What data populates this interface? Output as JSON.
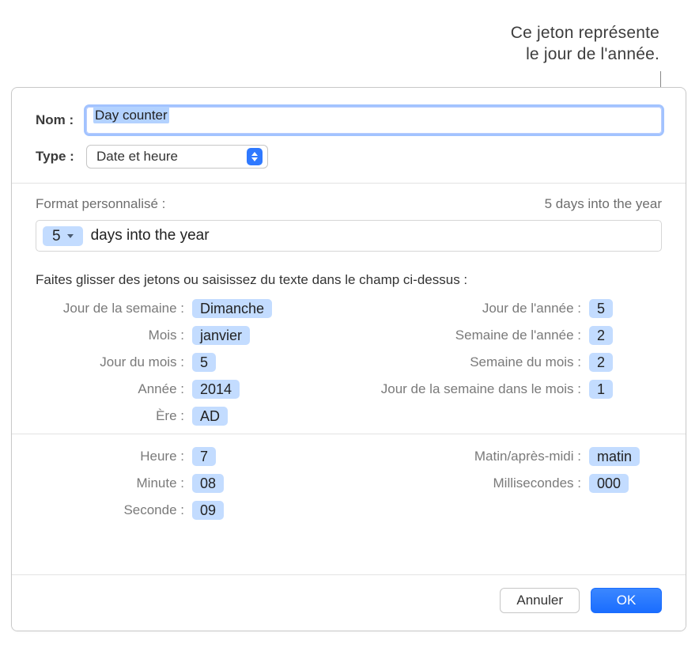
{
  "annotation": {
    "line1": "Ce jeton représente",
    "line2": "le jour de l'année."
  },
  "form": {
    "name_label": "Nom :",
    "name_value": "Day counter",
    "type_label": "Type :",
    "type_value": "Date et heure"
  },
  "format": {
    "header_label": "Format personnalisé :",
    "preview": "5 days into the year",
    "box_token_value": "5",
    "box_text": "days into the year"
  },
  "instruction": "Faites glisser des jetons ou saisissez du texte dans le champ ci-dessus :",
  "date_tokens": {
    "left": [
      {
        "label": "Jour de la semaine :",
        "value": "Dimanche"
      },
      {
        "label": "Mois :",
        "value": "janvier"
      },
      {
        "label": "Jour du mois :",
        "value": "5"
      },
      {
        "label": "Année :",
        "value": "2014"
      },
      {
        "label": "Ère :",
        "value": "AD"
      }
    ],
    "right": [
      {
        "label": "Jour de l'année :",
        "value": "5"
      },
      {
        "label": "Semaine de l'année :",
        "value": "2"
      },
      {
        "label": "Semaine du mois :",
        "value": "2"
      },
      {
        "label": "Jour de la semaine dans le mois :",
        "value": "1"
      }
    ]
  },
  "time_tokens": {
    "left": [
      {
        "label": "Heure :",
        "value": "7"
      },
      {
        "label": "Minute :",
        "value": "08"
      },
      {
        "label": "Seconde :",
        "value": "09"
      }
    ],
    "right": [
      {
        "label": "Matin/après-midi :",
        "value": "matin"
      },
      {
        "label": "Millisecondes :",
        "value": "000"
      }
    ]
  },
  "footer": {
    "cancel": "Annuler",
    "ok": "OK"
  }
}
